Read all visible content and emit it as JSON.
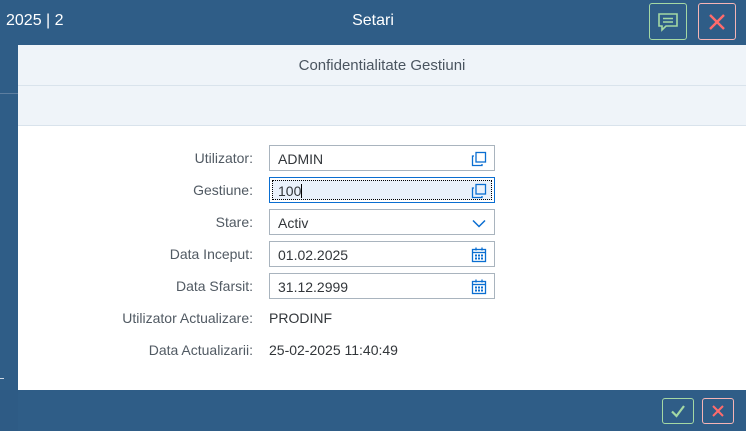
{
  "header": {
    "left_title": "2025 | 2",
    "title": "Setari",
    "feedback_icon": "feedback-icon",
    "close_icon": "close-icon"
  },
  "dialog": {
    "title": "Confidentialitate Gestiuni"
  },
  "form": {
    "utilizator": {
      "label": "Utilizator:",
      "value": "ADMIN"
    },
    "gestiune": {
      "label": "Gestiune:",
      "value": "100"
    },
    "stare": {
      "label": "Stare:",
      "value": "Activ"
    },
    "data_inceput": {
      "label": "Data Inceput:",
      "value": "01.02.2025"
    },
    "data_sfarsit": {
      "label": "Data Sfarsit:",
      "value": "31.12.2999"
    },
    "utilizator_actualizare": {
      "label": "Utilizator Actualizare:",
      "value": "PRODINF"
    },
    "data_actualizarii": {
      "label": "Data Actualizarii:",
      "value": "25-02-2025 11:40:49"
    }
  },
  "footer": {
    "ok_icon": "checkmark-icon",
    "cancel_icon": "close-icon"
  },
  "colors": {
    "shell_blue": "#2f5d87",
    "accept_green": "#a4d8a4",
    "reject_red": "#f6b5b5",
    "header_bg": "#eff4f9"
  }
}
